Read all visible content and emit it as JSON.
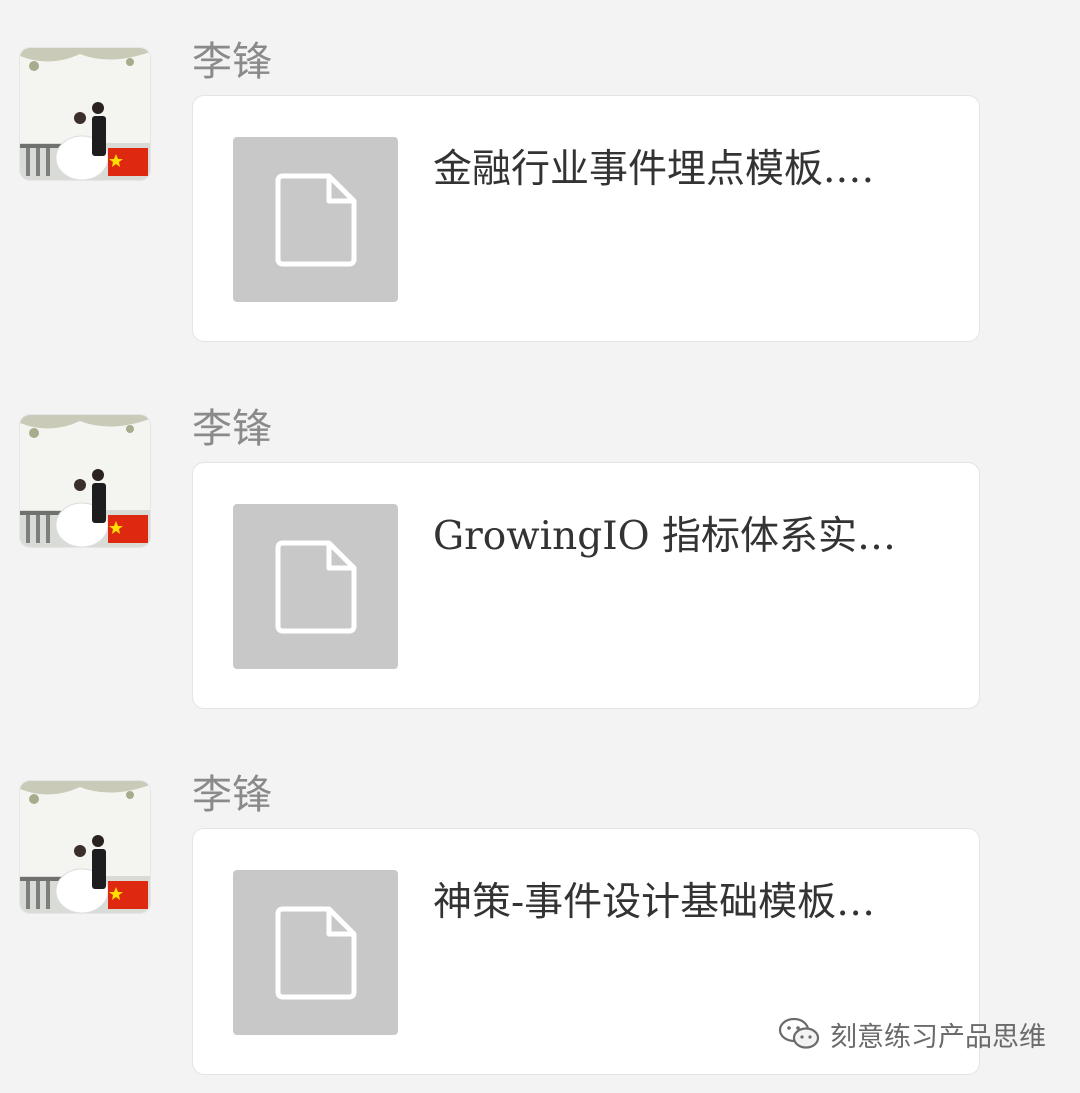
{
  "messages": [
    {
      "sender": "李锋",
      "file_name": "金融行业事件埋点模板.…",
      "file_icon": "document-icon"
    },
    {
      "sender": "李锋",
      "file_name": "GrowingIO 指标体系实…",
      "file_icon": "document-icon"
    },
    {
      "sender": "李锋",
      "file_name": "神策-事件设计基础模板…",
      "file_icon": "document-icon"
    }
  ],
  "watermark": {
    "icon": "wechat-icon",
    "text": "刻意练习产品思维"
  },
  "colors": {
    "background": "#f3f3f3",
    "card": "#ffffff",
    "thumb": "#c8c8c8",
    "sender_text": "#8a8a8a",
    "file_text": "#333333"
  }
}
